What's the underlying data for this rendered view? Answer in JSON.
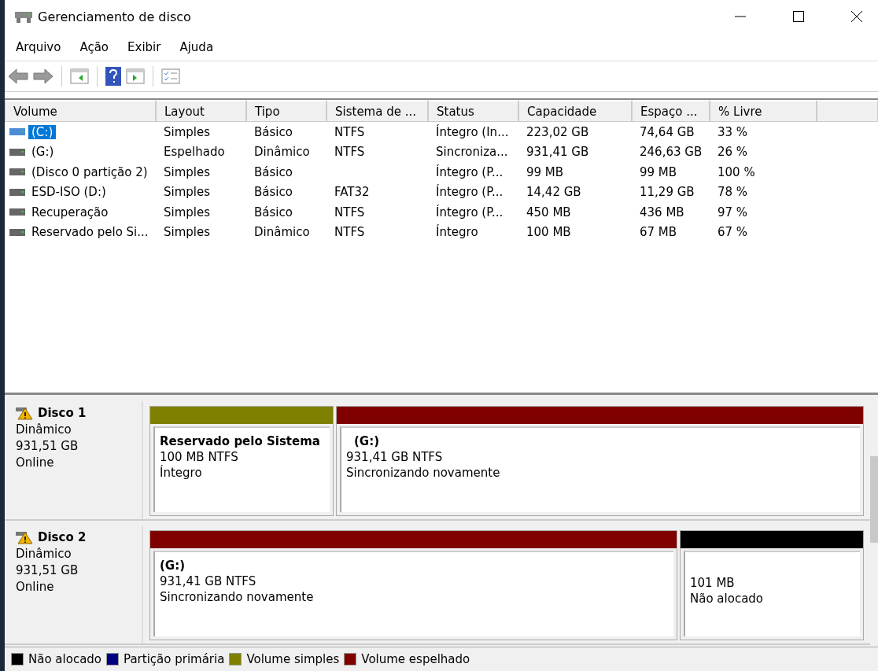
{
  "window": {
    "title": "Gerenciamento de disco"
  },
  "menu": [
    "Arquivo",
    "Ação",
    "Exibir",
    "Ajuda"
  ],
  "table": {
    "columns": [
      "Volume",
      "Layout",
      "Tipo",
      "Sistema de ...",
      "Status",
      "Capacidade",
      "Espaço ...",
      "% Livre"
    ],
    "rows": [
      {
        "selected": true,
        "cells": [
          "(C:)",
          "Simples",
          "Básico",
          "NTFS",
          "Íntegro (In...",
          "223,02 GB",
          "74,64 GB",
          "33 %"
        ]
      },
      {
        "selected": false,
        "cells": [
          "(G:)",
          "Espelhado",
          "Dinâmico",
          "NTFS",
          "Sincroniza...",
          "931,41 GB",
          "246,63 GB",
          "26 %"
        ]
      },
      {
        "selected": false,
        "cells": [
          "(Disco 0 partição 2)",
          "Simples",
          "Básico",
          "",
          "Íntegro (P...",
          "99 MB",
          "99 MB",
          "100 %"
        ]
      },
      {
        "selected": false,
        "cells": [
          "ESD-ISO (D:)",
          "Simples",
          "Básico",
          "FAT32",
          "Íntegro (P...",
          "14,42 GB",
          "11,29 GB",
          "78 %"
        ]
      },
      {
        "selected": false,
        "cells": [
          "Recuperação",
          "Simples",
          "Básico",
          "NTFS",
          "Íntegro (P...",
          "450 MB",
          "436 MB",
          "97 %"
        ]
      },
      {
        "selected": false,
        "cells": [
          "Reservado pelo Si...",
          "Simples",
          "Dinâmico",
          "NTFS",
          "Íntegro",
          "100 MB",
          "67 MB",
          "67 %"
        ]
      }
    ]
  },
  "disks": [
    {
      "name": "Disco 1",
      "type": "Dinâmico",
      "size": "931,51 GB",
      "status": "Online",
      "partitions": [
        {
          "color": "#808000",
          "name": "Reservado pelo Sistema",
          "size": "100 MB NTFS",
          "status": "Íntegro"
        },
        {
          "color": "#800000",
          "name": "(G:)",
          "size": "931,41 GB NTFS",
          "status": "Sincronizando novamente"
        }
      ]
    },
    {
      "name": "Disco 2",
      "type": "Dinâmico",
      "size": "931,51 GB",
      "status": "Online",
      "partitions": [
        {
          "color": "#800000",
          "name": "(G:)",
          "size": "931,41 GB NTFS",
          "status": "Sincronizando novamente"
        },
        {
          "color": "#000000",
          "size": "101 MB",
          "status": "Não alocado"
        }
      ]
    }
  ],
  "legend": [
    {
      "color": "#000000",
      "label": "Não alocado"
    },
    {
      "color": "#000080",
      "label": "Partição primária"
    },
    {
      "color": "#808000",
      "label": "Volume simples"
    },
    {
      "color": "#800000",
      "label": "Volume espelhado"
    }
  ]
}
